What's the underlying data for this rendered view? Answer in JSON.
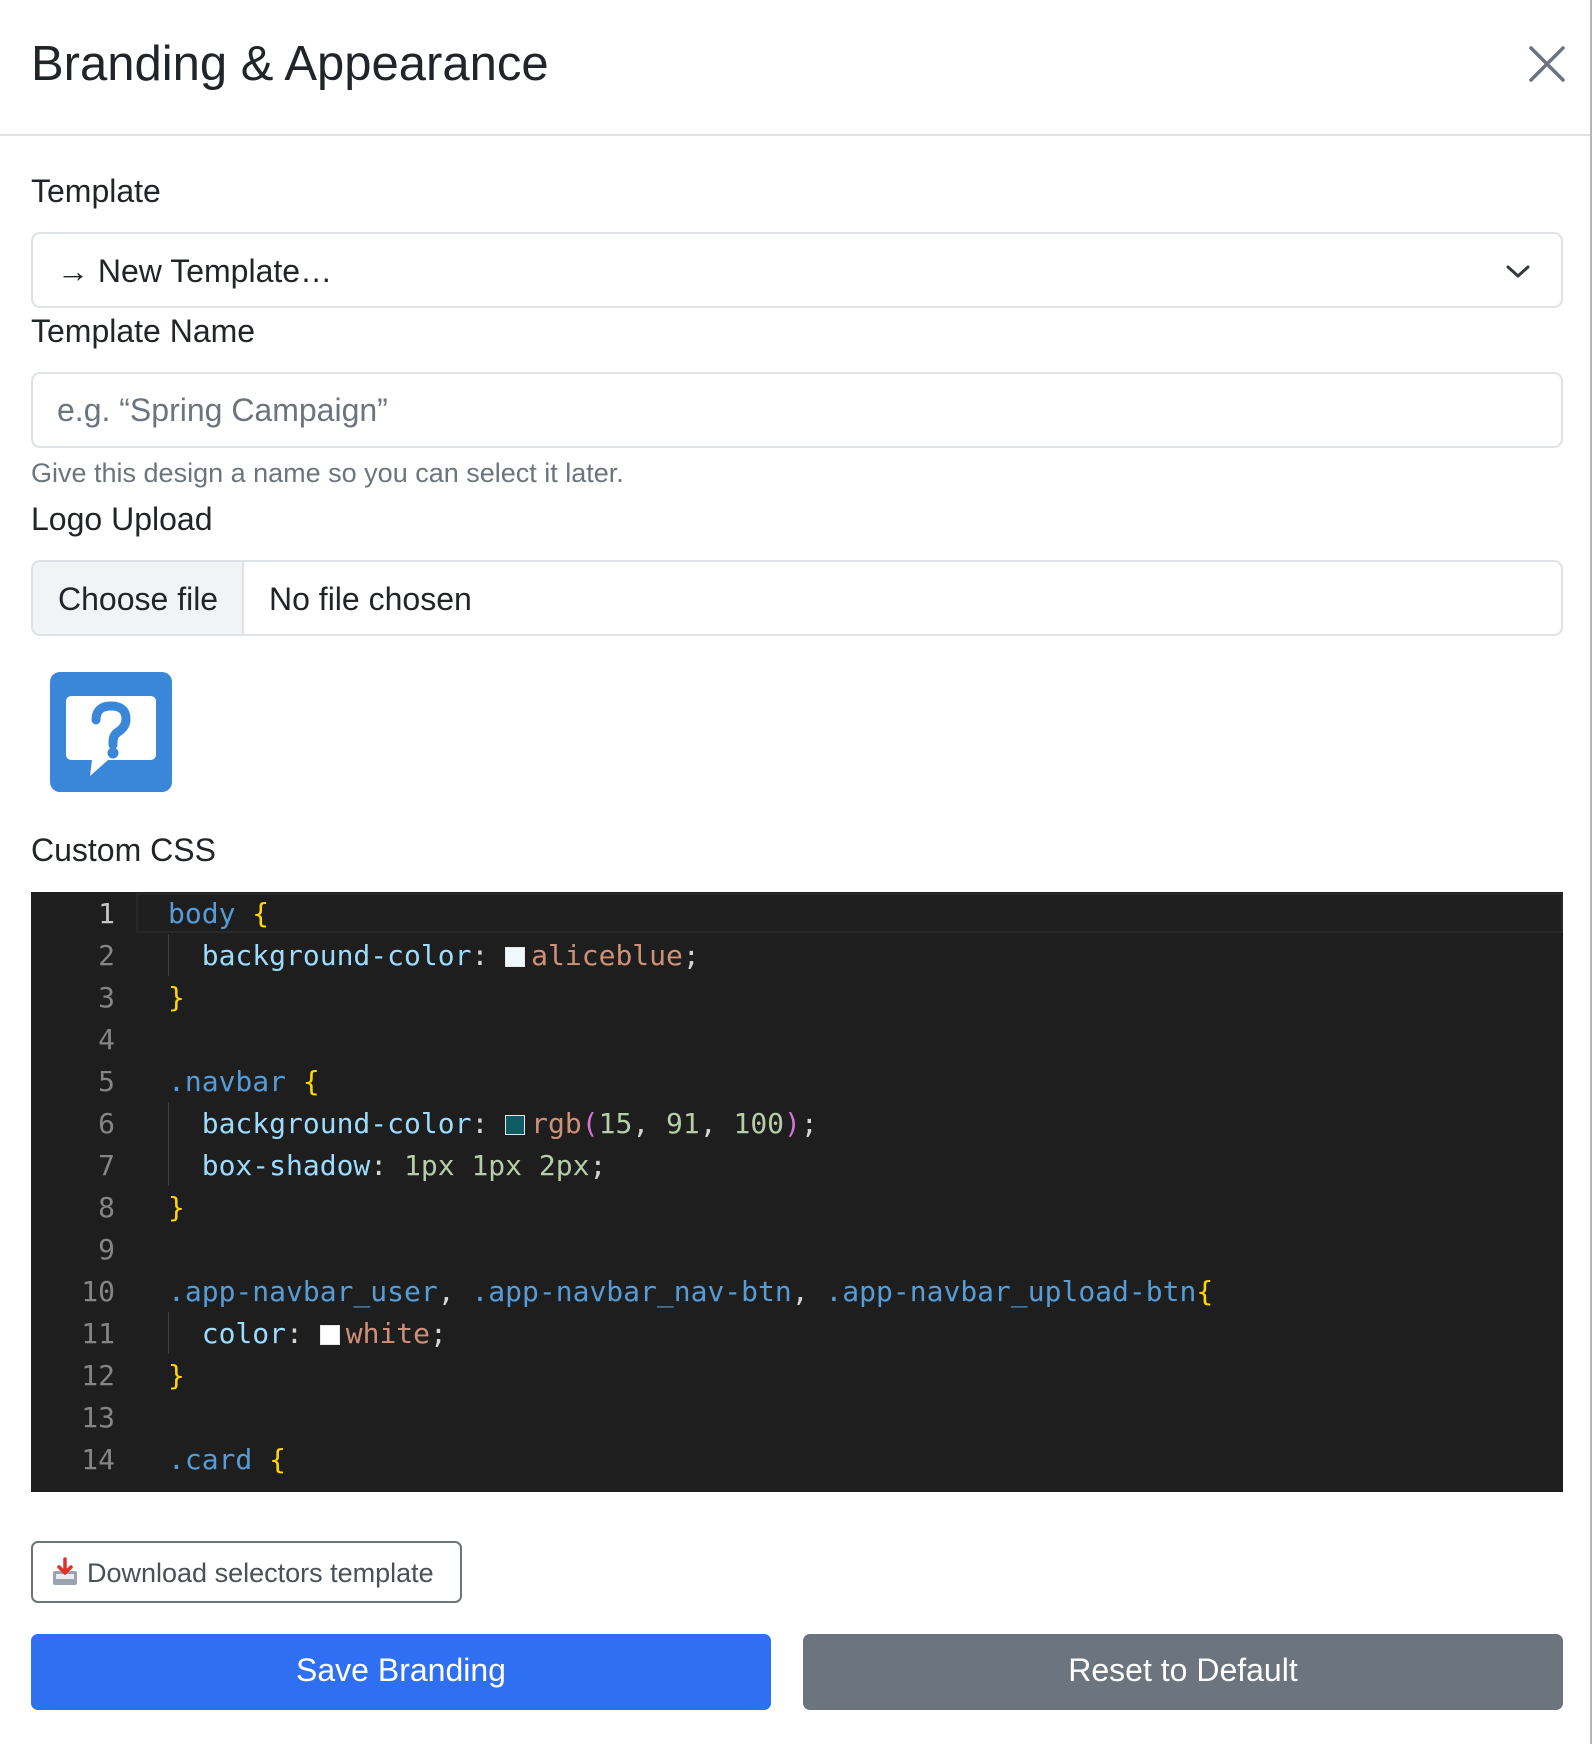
{
  "modal": {
    "title": "Branding & Appearance"
  },
  "template": {
    "label": "Template",
    "selected": "→ New Template…"
  },
  "template_name": {
    "label": "Template Name",
    "placeholder": "e.g. “Spring Campaign”",
    "value": "",
    "help": "Give this design a name so you can select it later."
  },
  "logo_upload": {
    "label": "Logo Upload",
    "button_label": "Choose file",
    "status": "No file chosen"
  },
  "custom_css": {
    "label": "Custom CSS",
    "active_line": 1,
    "lines": [
      {
        "n": "1",
        "code": "body {"
      },
      {
        "n": "2",
        "code": "  background-color: aliceblue;",
        "swatch": "#f0f8ff"
      },
      {
        "n": "3",
        "code": "}"
      },
      {
        "n": "4",
        "code": ""
      },
      {
        "n": "5",
        "code": ".navbar {"
      },
      {
        "n": "6",
        "code": "  background-color: rgb(15, 91, 100);",
        "swatch": "#0f5b64"
      },
      {
        "n": "7",
        "code": "  box-shadow: 1px 1px 2px;"
      },
      {
        "n": "8",
        "code": "}"
      },
      {
        "n": "9",
        "code": ""
      },
      {
        "n": "10",
        "code": ".app-navbar_user, .app-navbar_nav-btn, .app-navbar_upload-btn{"
      },
      {
        "n": "11",
        "code": "  color: white;",
        "swatch": "#ffffff"
      },
      {
        "n": "12",
        "code": "}"
      },
      {
        "n": "13",
        "code": ""
      },
      {
        "n": "14",
        "code": ".card {"
      }
    ]
  },
  "actions": {
    "download_label": "Download selectors template",
    "save_label": "Save Branding",
    "reset_label": "Reset to Default"
  },
  "colors": {
    "primary": "#2f6ff2",
    "secondary": "#6c757d",
    "logo_blue": "#3a86d8",
    "editor_bg": "#1e1e1e"
  },
  "icons": {
    "close": "close-icon",
    "chevron": "chevron-down-icon",
    "logo": "help-chat-icon",
    "download": "download-tray-icon"
  }
}
